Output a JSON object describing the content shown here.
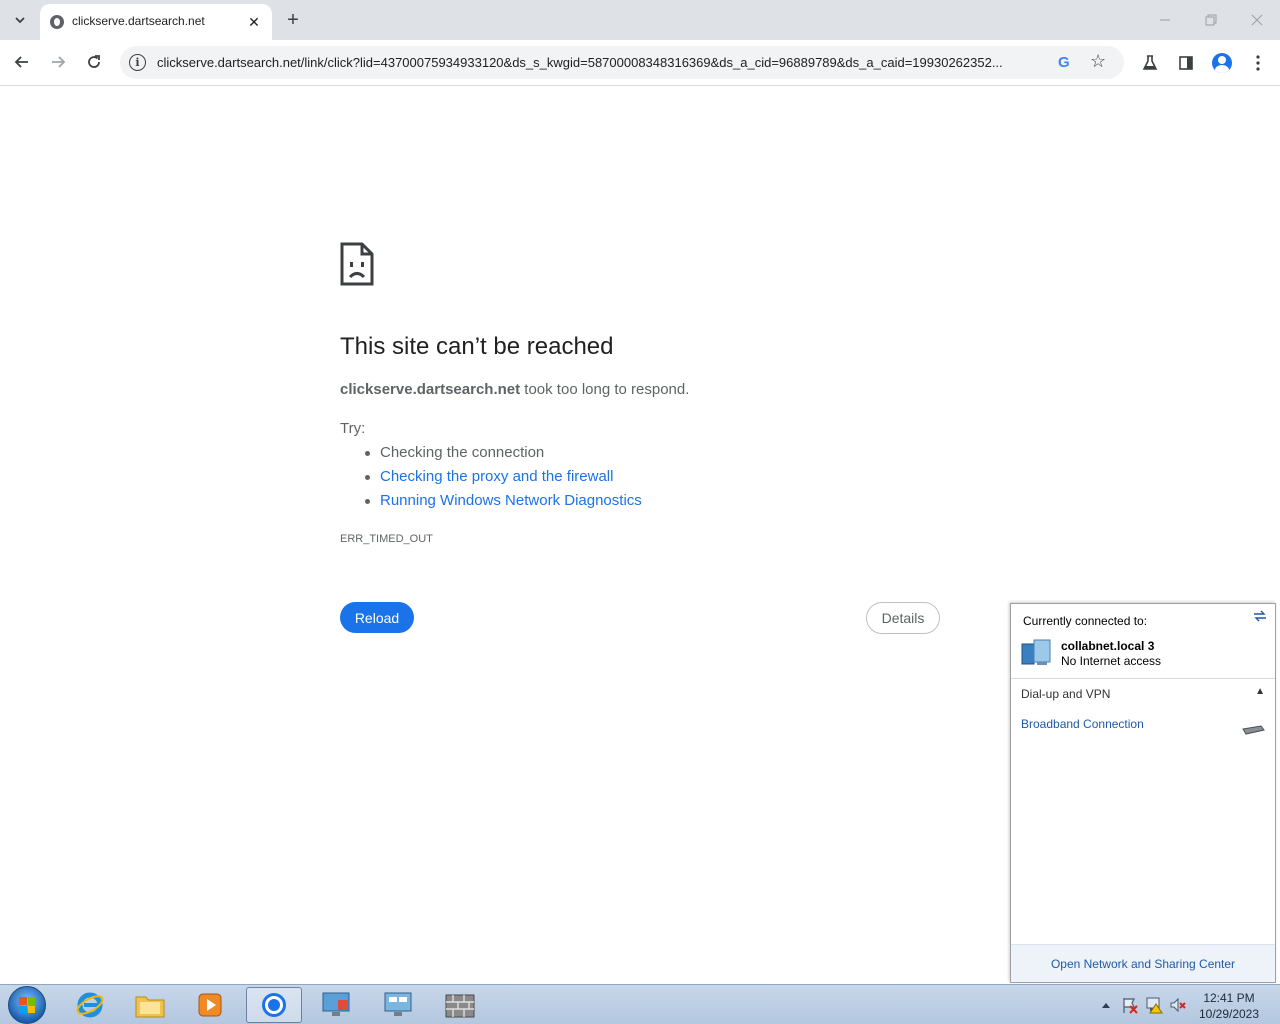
{
  "browser": {
    "tab": {
      "title": "clickserve.dartsearch.net",
      "close_glyph": "✕"
    },
    "new_tab_glyph": "+",
    "url": "clickserve.dartsearch.net/link/click?lid=43700075934933120&ds_s_kwgid=58700008348316369&ds_a_cid=96889789&ds_a_caid=19930262352...",
    "google_glyph": "G"
  },
  "error_page": {
    "title": "This site can’t be reached",
    "host": "clickserve.dartsearch.net",
    "message_suffix": " took too long to respond.",
    "try_label": "Try:",
    "suggestions": [
      "Checking the connection",
      "Checking the proxy and the firewall",
      "Running Windows Network Diagnostics"
    ],
    "error_code": "ERR_TIMED_OUT",
    "reload_label": "Reload",
    "details_label": "Details"
  },
  "network_flyout": {
    "header": "Currently connected to:",
    "network_name": "collabnet.local  3",
    "network_status": "No Internet access",
    "dialup_label": "Dial-up and VPN",
    "broadband_label": "Broadband Connection",
    "footer_link": "Open Network and Sharing Center"
  },
  "taskbar": {
    "time": "12:41 PM",
    "date": "10/29/2023"
  },
  "colors": {
    "accent": "#1a73e8",
    "taskbar": "#b9cce3",
    "link_win": "#1e5aa8"
  },
  "icons": [
    "tab-search-icon",
    "globe-favicon-icon",
    "close-icon",
    "back-arrow-icon",
    "forward-arrow-icon",
    "reload-icon",
    "info-icon",
    "google-icon",
    "star-icon",
    "labs-flask-icon",
    "side-panel-icon",
    "profile-icon",
    "kebab-menu-icon",
    "sad-page-icon",
    "network-computer-icon",
    "modem-icon"
  ]
}
